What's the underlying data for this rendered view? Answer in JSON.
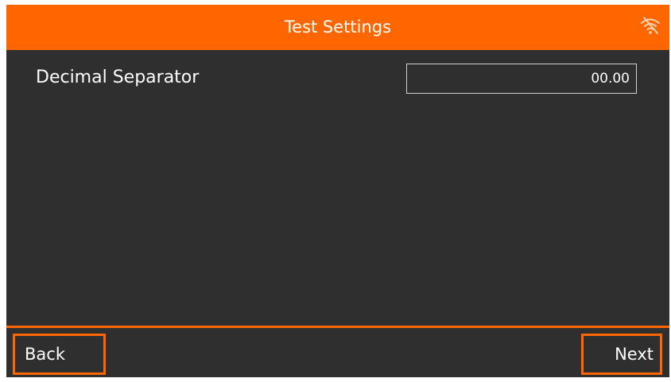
{
  "header": {
    "title": "Test Settings",
    "status_icon": "wifi-off-icon",
    "accent_color": "#ff6600",
    "background_color": "#2f2f2f"
  },
  "settings": {
    "decimal_separator": {
      "label": "Decimal Separator",
      "value": "00.00"
    }
  },
  "footer": {
    "back_label": "Back",
    "next_label": "Next"
  }
}
